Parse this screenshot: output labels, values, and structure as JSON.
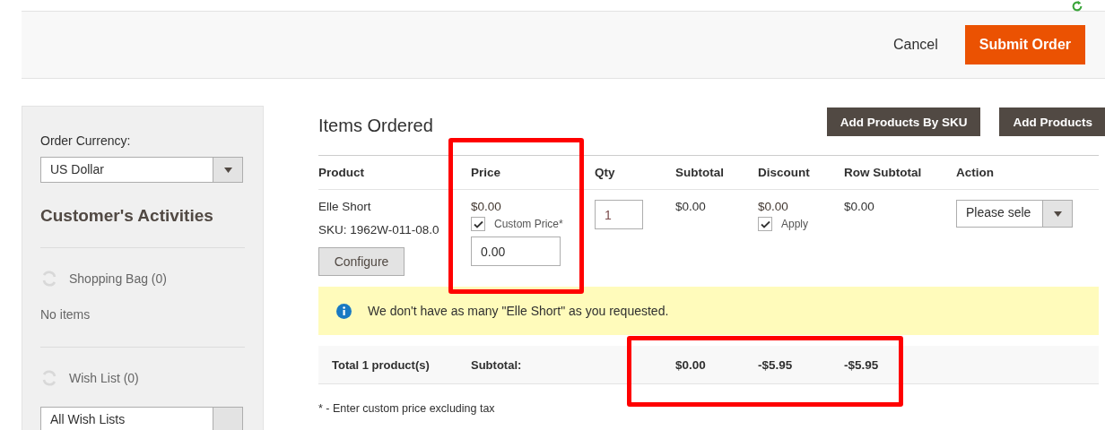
{
  "toolbar": {
    "cancel": "Cancel",
    "submit": "Submit Order"
  },
  "sidebar": {
    "currency_label": "Order Currency:",
    "currency": "US Dollar",
    "activities_title": "Customer's Activities",
    "sections": [
      {
        "title": "Shopping Bag (0)",
        "empty_text": "No items"
      },
      {
        "title": "Wish List (0)",
        "select": "All Wish Lists"
      }
    ]
  },
  "items": {
    "title": "Items Ordered",
    "buttons": [
      "Add Products By SKU",
      "Add Products"
    ],
    "columns": [
      "Product",
      "Price",
      "Qty",
      "Subtotal",
      "Discount",
      "Row Subtotal",
      "Action"
    ],
    "rows": [
      {
        "product": "Elle Short",
        "sku": "SKU: 1962W-011-08.0",
        "configure": "Configure",
        "price": "$0.00",
        "custom_price_checked": true,
        "custom_price_label": "Custom Price*",
        "custom_price": "0.00",
        "qty": "1",
        "subtotal": "$0.00",
        "discount": "$0.00",
        "apply_checked": true,
        "apply_label": "Apply",
        "row_subtotal": "$0.00",
        "action": "Please sele"
      }
    ],
    "notice": "We don't have as many \"Elle Short\" as you requested.",
    "totals": {
      "label": "Total 1 product(s)",
      "subtotal_label": "Subtotal:",
      "subtotal": "$0.00",
      "discount": "-$5.95",
      "row_subtotal": "-$5.95"
    },
    "footnote": "* - Enter custom price excluding tax"
  }
}
